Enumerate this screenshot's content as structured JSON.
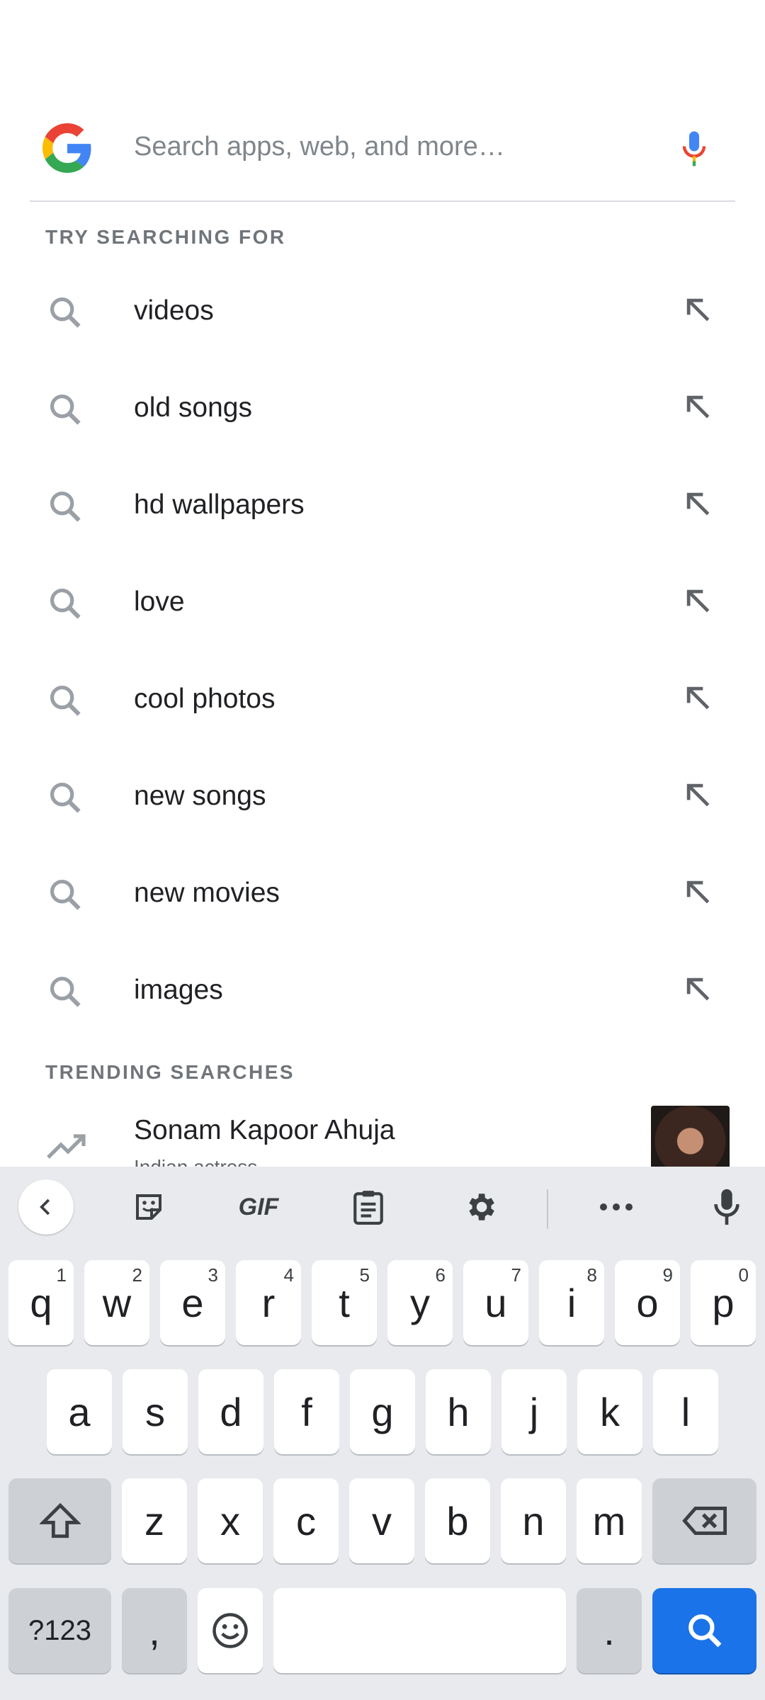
{
  "search": {
    "placeholder": "Search apps, web, and more…",
    "logo": "google-g-logo",
    "voice_icon": "mic-icon"
  },
  "try_section": {
    "label": "TRY SEARCHING FOR",
    "items": [
      {
        "label": "videos"
      },
      {
        "label": "old songs"
      },
      {
        "label": "hd wallpapers"
      },
      {
        "label": "love"
      },
      {
        "label": "cool photos"
      },
      {
        "label": "new songs"
      },
      {
        "label": "new movies"
      },
      {
        "label": "images"
      }
    ]
  },
  "trending_section": {
    "label": "TRENDING SEARCHES",
    "items": [
      {
        "title": "Sonam Kapoor Ahuja",
        "subtitle": "Indian actress"
      }
    ]
  },
  "keyboard": {
    "toolbar": [
      "back-icon",
      "sticker-icon",
      "GIF",
      "clipboard-icon",
      "settings-icon",
      "more-icon",
      "mic-icon"
    ],
    "gif_label": "GIF",
    "row1": [
      {
        "key": "q",
        "num": "1"
      },
      {
        "key": "w",
        "num": "2"
      },
      {
        "key": "e",
        "num": "3"
      },
      {
        "key": "r",
        "num": "4"
      },
      {
        "key": "t",
        "num": "5"
      },
      {
        "key": "y",
        "num": "6"
      },
      {
        "key": "u",
        "num": "7"
      },
      {
        "key": "i",
        "num": "8"
      },
      {
        "key": "o",
        "num": "9"
      },
      {
        "key": "p",
        "num": "0"
      }
    ],
    "row2": [
      "a",
      "s",
      "d",
      "f",
      "g",
      "h",
      "j",
      "k",
      "l"
    ],
    "row3": [
      "z",
      "x",
      "c",
      "v",
      "b",
      "n",
      "m"
    ],
    "row4": {
      "symbols": "?123",
      "comma": ",",
      "period": "."
    }
  },
  "colors": {
    "accent": "#1a73e8",
    "keyboard_bg": "#e8eaed",
    "google_blue": "#4285f4",
    "google_red": "#ea4335",
    "google_yellow": "#fbbc05",
    "google_green": "#34a853"
  }
}
